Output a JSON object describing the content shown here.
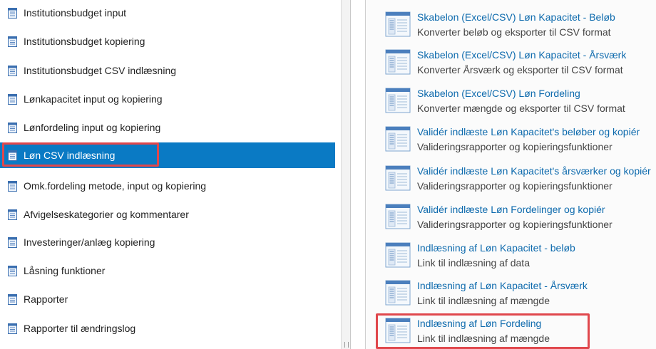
{
  "nav": {
    "items": [
      {
        "label": "Institutionsbudget input",
        "selected": false
      },
      {
        "label": "Institutionsbudget kopiering",
        "selected": false
      },
      {
        "label": "Institutionsbudget CSV indlæsning",
        "selected": false
      },
      {
        "label": "Lønkapacitet input og kopiering",
        "selected": false
      },
      {
        "label": "Lønfordeling input og kopiering",
        "selected": false
      },
      {
        "label": "Løn CSV indlæsning",
        "selected": true
      },
      {
        "label": "Omk.fordeling metode, input og kopiering",
        "selected": false
      },
      {
        "label": "Afvigelseskategorier og kommentarer",
        "selected": false
      },
      {
        "label": "Investeringer/anlæg kopiering",
        "selected": false
      },
      {
        "label": "Låsning funktioner",
        "selected": false
      },
      {
        "label": "Rapporter",
        "selected": false
      },
      {
        "label": "Rapporter til ændringslog",
        "selected": false
      }
    ]
  },
  "panel": {
    "tiles": [
      {
        "title": "Skabelon (Excel/CSV) Løn Kapacitet - Beløb",
        "description": "Konverter beløb og eksporter til CSV format"
      },
      {
        "title": "Skabelon (Excel/CSV) Løn Kapacitet - Årsværk",
        "description": "Konverter Årsværk og eksporter til CSV format"
      },
      {
        "title": "Skabelon (Excel/CSV) Løn Fordeling",
        "description": "Konverter mængde og eksporter til CSV format"
      },
      {
        "title": "Validér indlæste Løn Kapacitet's beløber og kopiér",
        "description": "Valideringsrapporter og kopieringsfunktioner"
      },
      {
        "title": "Validér indlæste Løn Kapacitet's årsværker og kopiér",
        "description": "Valideringsrapporter og kopieringsfunktioner"
      },
      {
        "title": "Validér indlæste Løn Fordelinger og kopiér",
        "description": "Valideringsrapporter og kopieringsfunktioner"
      },
      {
        "title": "Indlæsning af Løn Kapacitet - beløb",
        "description": "Link til indlæsning af data"
      },
      {
        "title": "Indlæsning af Løn Kapacitet - Årsværk",
        "description": "Link til indlæsning af mængde"
      },
      {
        "title": "Indlæsning af Løn Fordeling",
        "description": "Link til indlæsning af mængde"
      }
    ]
  },
  "colors": {
    "selected_bg": "#0a7ac4",
    "link_title": "#0d6aad",
    "annotation_red": "#e0474c"
  },
  "icons": {
    "nav_item": "document-icon",
    "tile": "report-template-icon"
  }
}
